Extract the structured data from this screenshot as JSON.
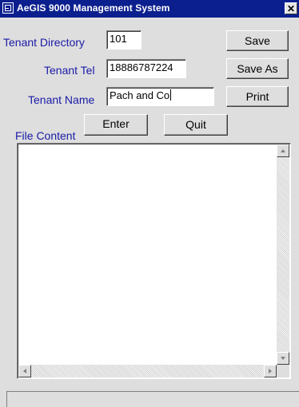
{
  "window": {
    "title": "AeGIS 9000 Management System",
    "close_glyph": "✕"
  },
  "form": {
    "tenant_directory": {
      "label": "Tenant Directory",
      "value": "101"
    },
    "tenant_tel": {
      "label": "Tenant Tel",
      "value": "18886787224"
    },
    "tenant_name": {
      "label": "Tenant Name",
      "value": "Pach and Co"
    },
    "file_content_label": "File Content"
  },
  "buttons": {
    "save": "Save",
    "save_as": "Save As",
    "print": "Print",
    "enter": "Enter",
    "quit": "Quit"
  },
  "file_content": {
    "text": ""
  },
  "colors": {
    "titlebar": "#0b1f8e",
    "label_text": "#1a1aa8",
    "window_bg": "#dedede"
  }
}
